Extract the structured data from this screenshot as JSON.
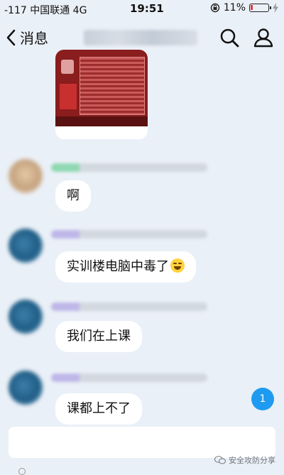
{
  "status_bar": {
    "carrier": "-117 中国联通 4G",
    "time": "19:51",
    "battery": "11%",
    "battery_level": 0.11
  },
  "nav": {
    "back_label": "消息"
  },
  "messages": [
    {
      "text": "啊"
    },
    {
      "text": "实训楼电脑中毒了"
    },
    {
      "text": "我们在上课"
    },
    {
      "text": "课都上不了"
    }
  ],
  "unread_count": "1",
  "input": {
    "placeholder": "",
    "value": ""
  },
  "watermark": "安全攻防分享",
  "colors": {
    "accent": "#1e9bf0",
    "background": "#eaf0f7",
    "bubble": "#ffffff",
    "battery_low": "#e53935"
  }
}
